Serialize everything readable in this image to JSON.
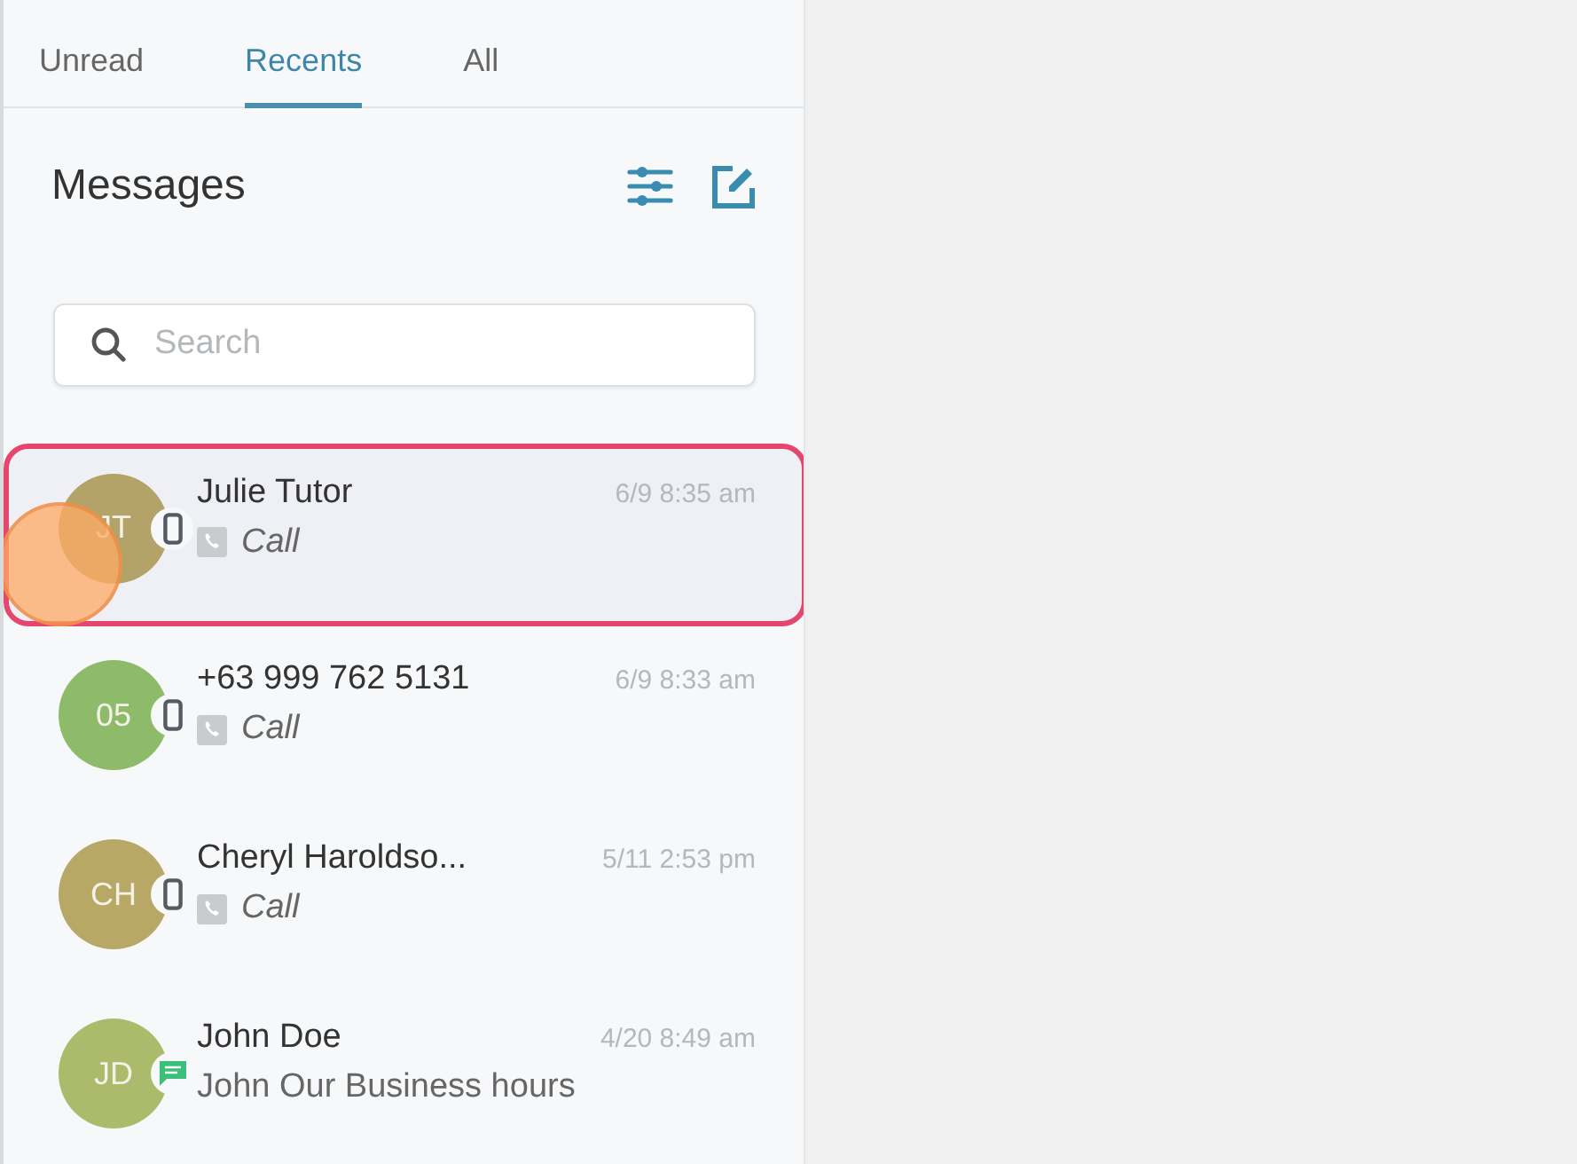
{
  "tabs": [
    {
      "label": "Unread",
      "selected": false
    },
    {
      "label": "Recents",
      "selected": true
    },
    {
      "label": "All",
      "selected": false
    }
  ],
  "title": "Messages",
  "search": {
    "placeholder": "Search"
  },
  "conversations": [
    {
      "initials": "JT",
      "color": "#b3a369",
      "name": "Julie Tutor",
      "time": "6/9 8:35 am",
      "kind": "call",
      "preview": "Call",
      "selected": true
    },
    {
      "initials": "05",
      "color": "#8dbb69",
      "name": "+63 999 762 5131",
      "time": "6/9 8:33 am",
      "kind": "call",
      "preview": "Call",
      "selected": false
    },
    {
      "initials": "CH",
      "color": "#b8a866",
      "name": "Cheryl Haroldso...",
      "time": "5/11 2:53 pm",
      "kind": "call",
      "preview": "Call",
      "selected": false
    },
    {
      "initials": "JD",
      "color": "#acbb6b",
      "name": "John Doe",
      "time": "4/20 8:49 am",
      "kind": "text",
      "preview": "John Our Business hours",
      "selected": false
    }
  ]
}
